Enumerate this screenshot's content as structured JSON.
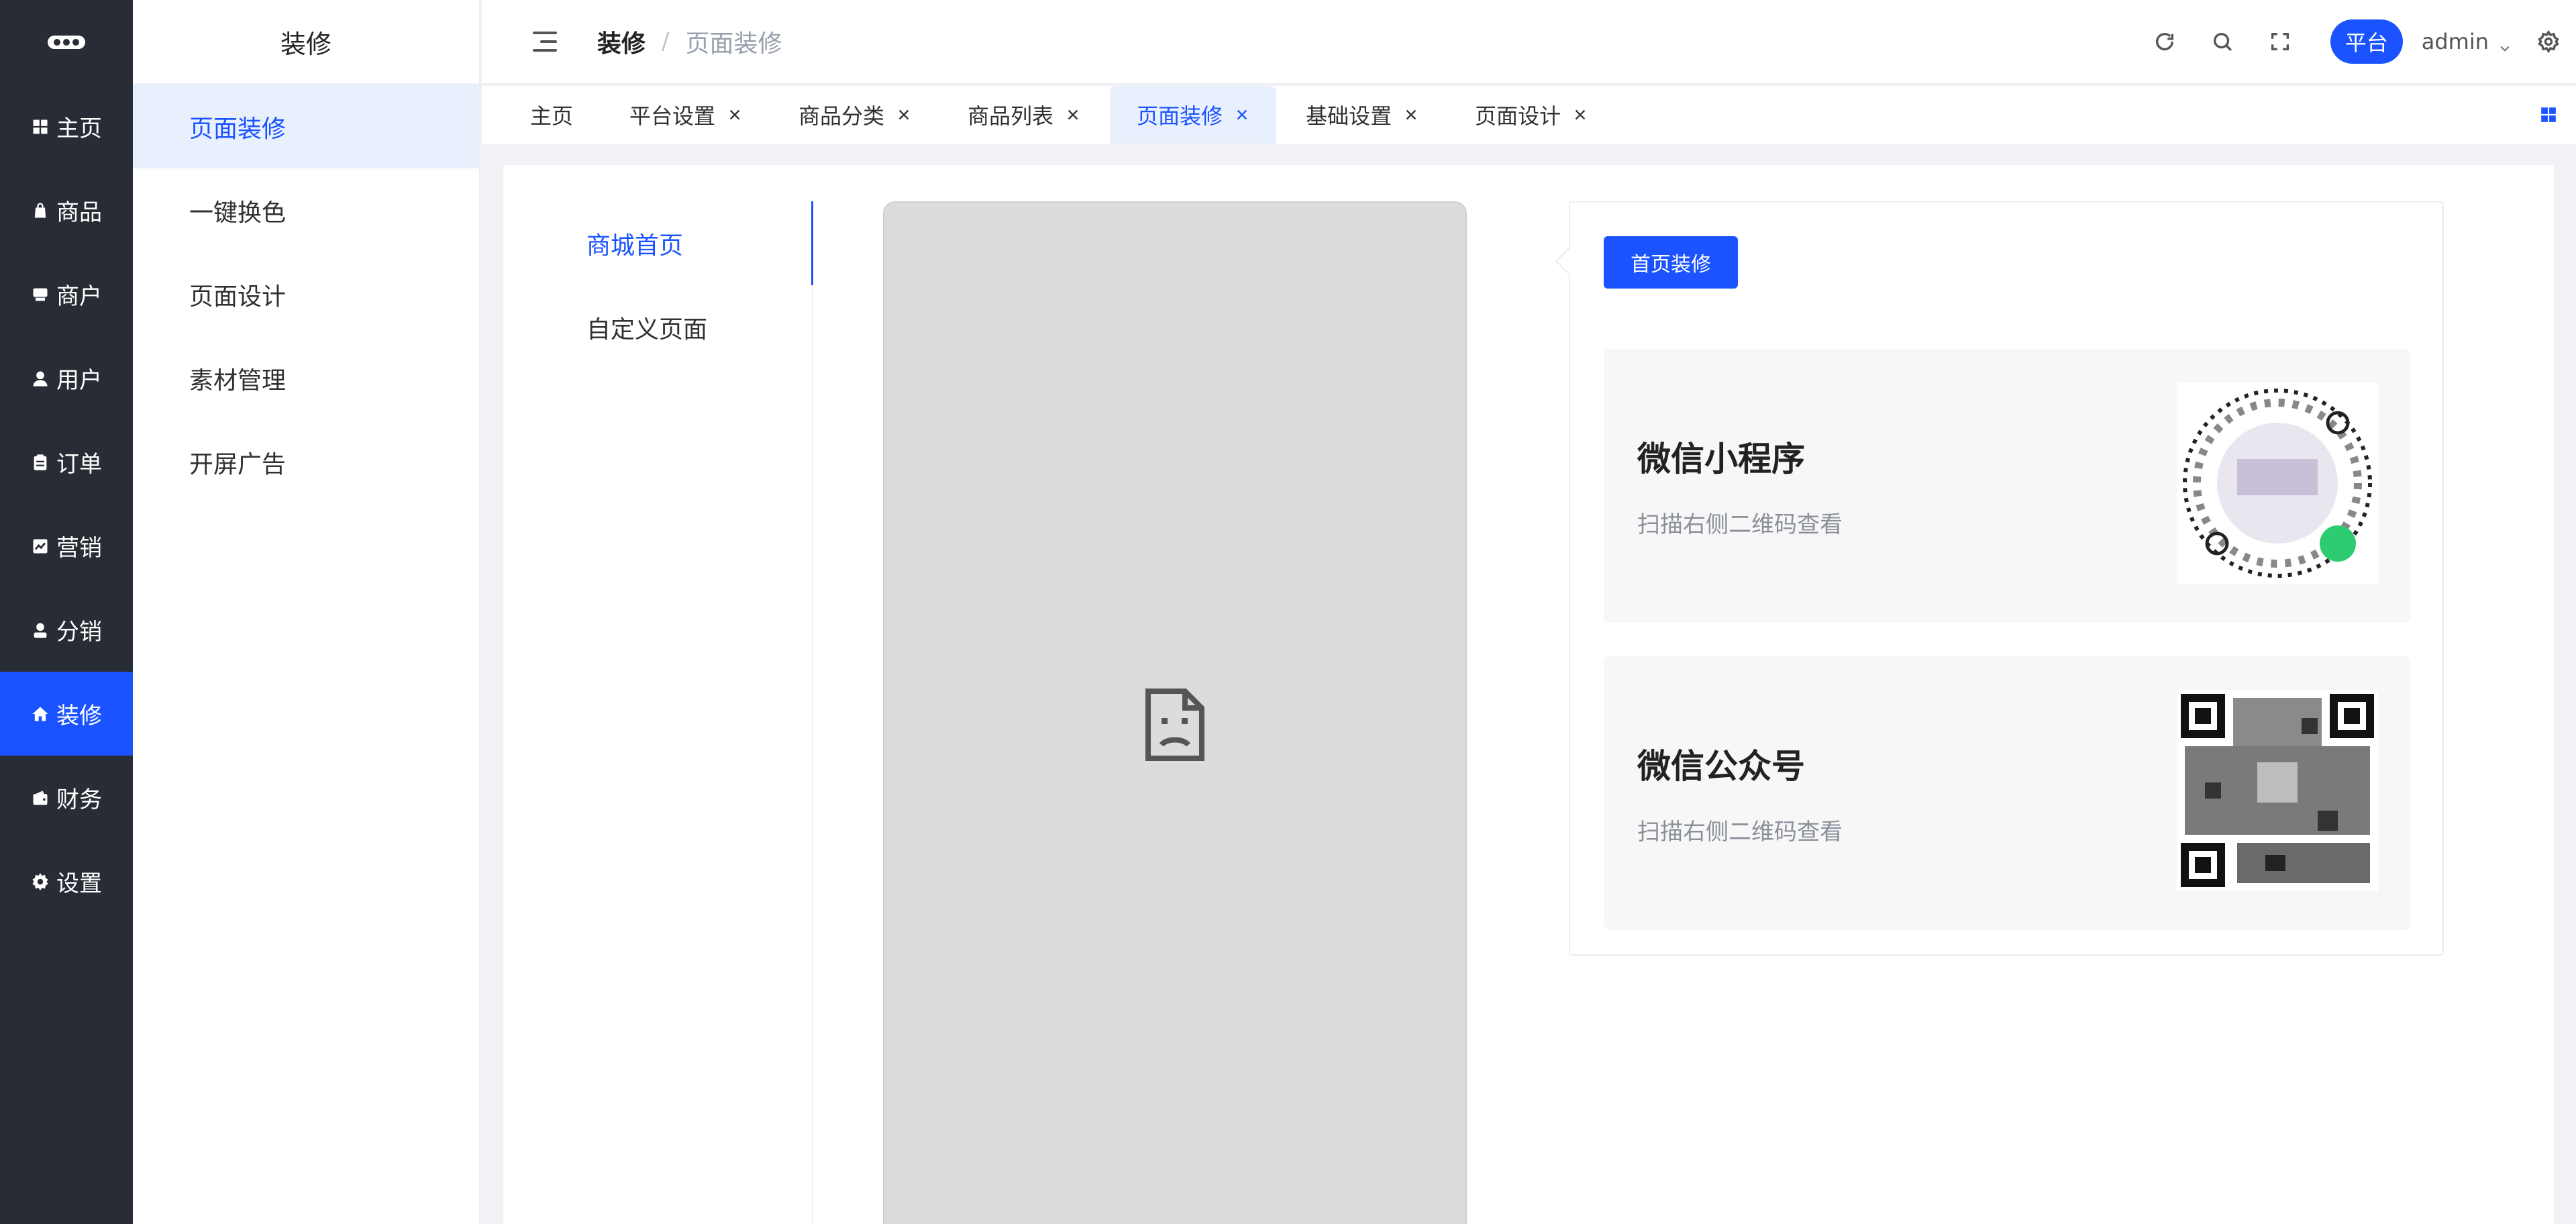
{
  "sidebar": {
    "items": [
      {
        "label": "主页",
        "icon": "dashboard-icon"
      },
      {
        "label": "商品",
        "icon": "bag-icon"
      },
      {
        "label": "商户",
        "icon": "store-icon"
      },
      {
        "label": "用户",
        "icon": "user-icon"
      },
      {
        "label": "订单",
        "icon": "clipboard-icon"
      },
      {
        "label": "营销",
        "icon": "chart-icon"
      },
      {
        "label": "分销",
        "icon": "person-icon"
      },
      {
        "label": "装修",
        "icon": "home-icon",
        "active": true
      },
      {
        "label": "财务",
        "icon": "wallet-icon"
      },
      {
        "label": "设置",
        "icon": "gear-icon"
      }
    ]
  },
  "submenu": {
    "title": "装修",
    "items": [
      {
        "label": "页面装修",
        "active": true
      },
      {
        "label": "一键换色"
      },
      {
        "label": "页面设计"
      },
      {
        "label": "素材管理"
      },
      {
        "label": "开屏广告"
      }
    ]
  },
  "header": {
    "breadcrumb_main": "装修",
    "breadcrumb_sep": "/",
    "breadcrumb_sub": "页面装修",
    "platform_label": "平台",
    "user_name": "admin"
  },
  "tabs": [
    {
      "label": "主页",
      "closable": false
    },
    {
      "label": "平台设置",
      "closable": true
    },
    {
      "label": "商品分类",
      "closable": true
    },
    {
      "label": "商品列表",
      "closable": true
    },
    {
      "label": "页面装修",
      "closable": true,
      "active": true
    },
    {
      "label": "基础设置",
      "closable": true
    },
    {
      "label": "页面设计",
      "closable": true
    }
  ],
  "page_nav": [
    {
      "label": "商城首页",
      "active": true
    },
    {
      "label": "自定义页面"
    }
  ],
  "panel": {
    "button_label": "首页装修",
    "cards": [
      {
        "title": "微信小程序",
        "desc": "扫描右侧二维码查看",
        "image": "mini-program-code"
      },
      {
        "title": "微信公众号",
        "desc": "扫描右侧二维码查看",
        "image": "qr-code"
      }
    ]
  },
  "colors": {
    "accent": "#1a53ff",
    "sidebar_bg": "#282c34",
    "active_tab_bg": "#e8f0fe"
  }
}
